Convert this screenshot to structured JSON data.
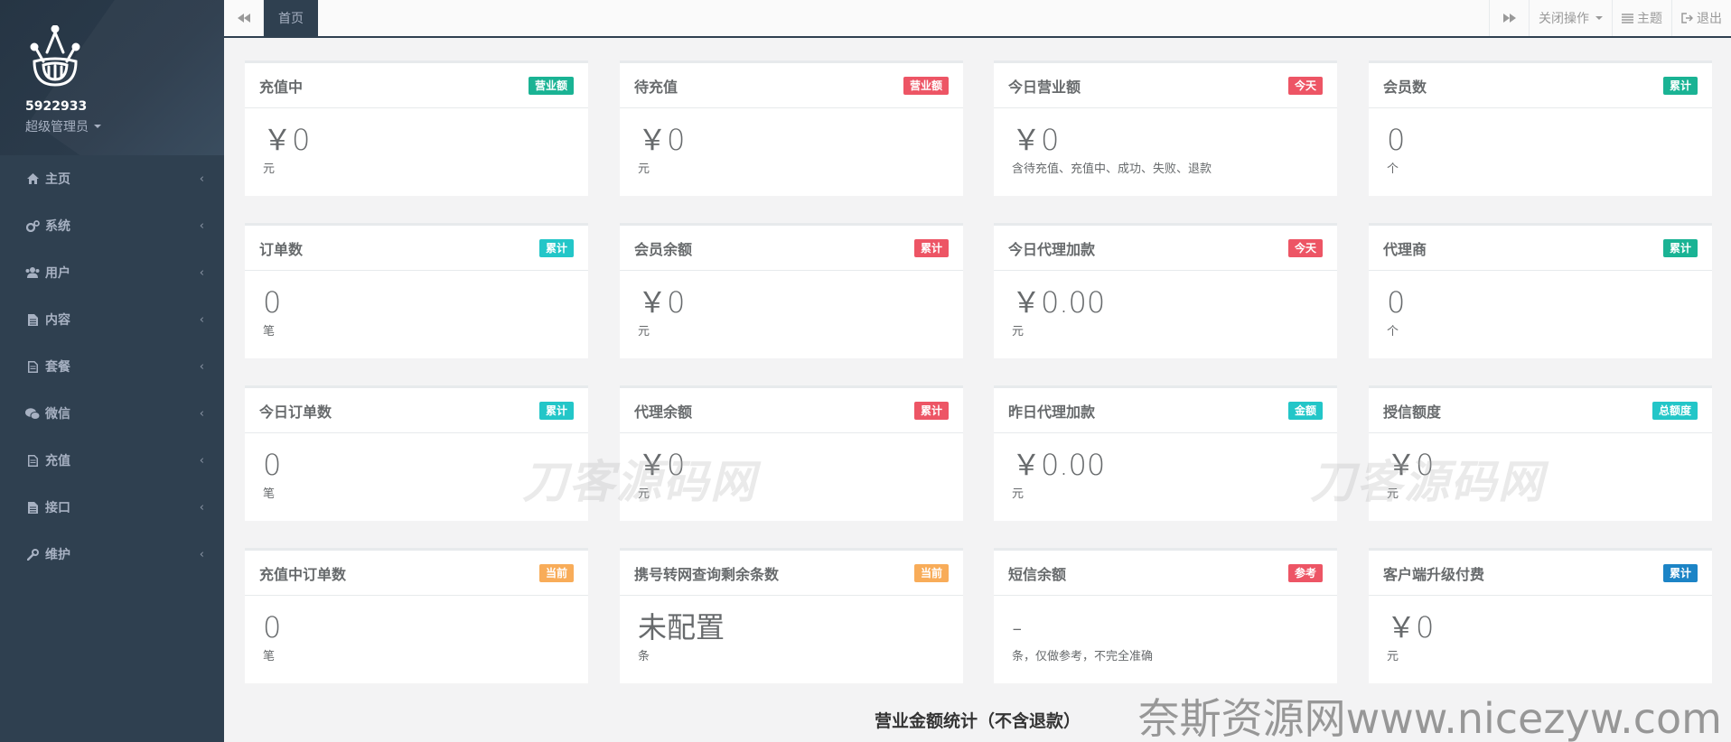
{
  "sidebar": {
    "username": "5922933",
    "role": "超级管理员",
    "items": [
      {
        "label": "主页",
        "icon": "home-icon"
      },
      {
        "label": "系统",
        "icon": "gears-icon"
      },
      {
        "label": "用户",
        "icon": "users-icon"
      },
      {
        "label": "内容",
        "icon": "file-icon"
      },
      {
        "label": "套餐",
        "icon": "file-text-icon"
      },
      {
        "label": "微信",
        "icon": "wechat-icon"
      },
      {
        "label": "充值",
        "icon": "file-text-icon"
      },
      {
        "label": "接口",
        "icon": "file-icon"
      },
      {
        "label": "维护",
        "icon": "wrench-icon"
      }
    ],
    "chevron": "‹"
  },
  "topbar": {
    "active_tab": "首页",
    "close_ops": "关闭操作",
    "theme": "主题",
    "logout": "退出"
  },
  "colors": {
    "green": "#1ab394",
    "red": "#ed5565",
    "cyan": "#23c6c8",
    "orange": "#f8ac59",
    "blue": "#1c84c6"
  },
  "cards": [
    {
      "title": "充值中",
      "badge": "营业额",
      "badge_color": "#1ab394",
      "value": "￥0",
      "unit": "元"
    },
    {
      "title": "待充值",
      "badge": "营业额",
      "badge_color": "#ed5565",
      "value": "￥0",
      "unit": "元"
    },
    {
      "title": "今日营业额",
      "badge": "今天",
      "badge_color": "#ed5565",
      "value": "￥0",
      "unit": "含待充值、充值中、成功、失败、退款"
    },
    {
      "title": "会员数",
      "badge": "累计",
      "badge_color": "#1ab394",
      "value": "0",
      "unit": "个"
    },
    {
      "title": "订单数",
      "badge": "累计",
      "badge_color": "#23c6c8",
      "value": "0",
      "unit": "笔"
    },
    {
      "title": "会员余额",
      "badge": "累计",
      "badge_color": "#ed5565",
      "value": "￥0",
      "unit": "元"
    },
    {
      "title": "今日代理加款",
      "badge": "今天",
      "badge_color": "#ed5565",
      "value": "￥0.00",
      "unit": "元"
    },
    {
      "title": "代理商",
      "badge": "累计",
      "badge_color": "#1ab394",
      "value": "0",
      "unit": "个"
    },
    {
      "title": "今日订单数",
      "badge": "累计",
      "badge_color": "#23c6c8",
      "value": "0",
      "unit": "笔"
    },
    {
      "title": "代理余额",
      "badge": "累计",
      "badge_color": "#ed5565",
      "value": "￥0",
      "unit": "元"
    },
    {
      "title": "昨日代理加款",
      "badge": "金额",
      "badge_color": "#23c6c8",
      "value": "￥0.00",
      "unit": "元"
    },
    {
      "title": "授信额度",
      "badge": "总额度",
      "badge_color": "#23c6c8",
      "value": "￥0",
      "unit": "元"
    },
    {
      "title": "充值中订单数",
      "badge": "当前",
      "badge_color": "#f8ac59",
      "value": "0",
      "unit": "笔"
    },
    {
      "title": "携号转网查询剩余条数",
      "badge": "当前",
      "badge_color": "#f8ac59",
      "value": "未配置",
      "unit": "条"
    },
    {
      "title": "短信余额",
      "badge": "参考",
      "badge_color": "#ed5565",
      "value": "-",
      "unit": "条，仅做参考，不完全准确"
    },
    {
      "title": "客户端升级付费",
      "badge": "累计",
      "badge_color": "#1c84c6",
      "value": "￥0",
      "unit": "元"
    }
  ],
  "section_title": "营业金额统计（不含退款）",
  "watermark_text": "刀客源码网",
  "footer_watermark": "奈斯资源网www.nicezyw.com"
}
